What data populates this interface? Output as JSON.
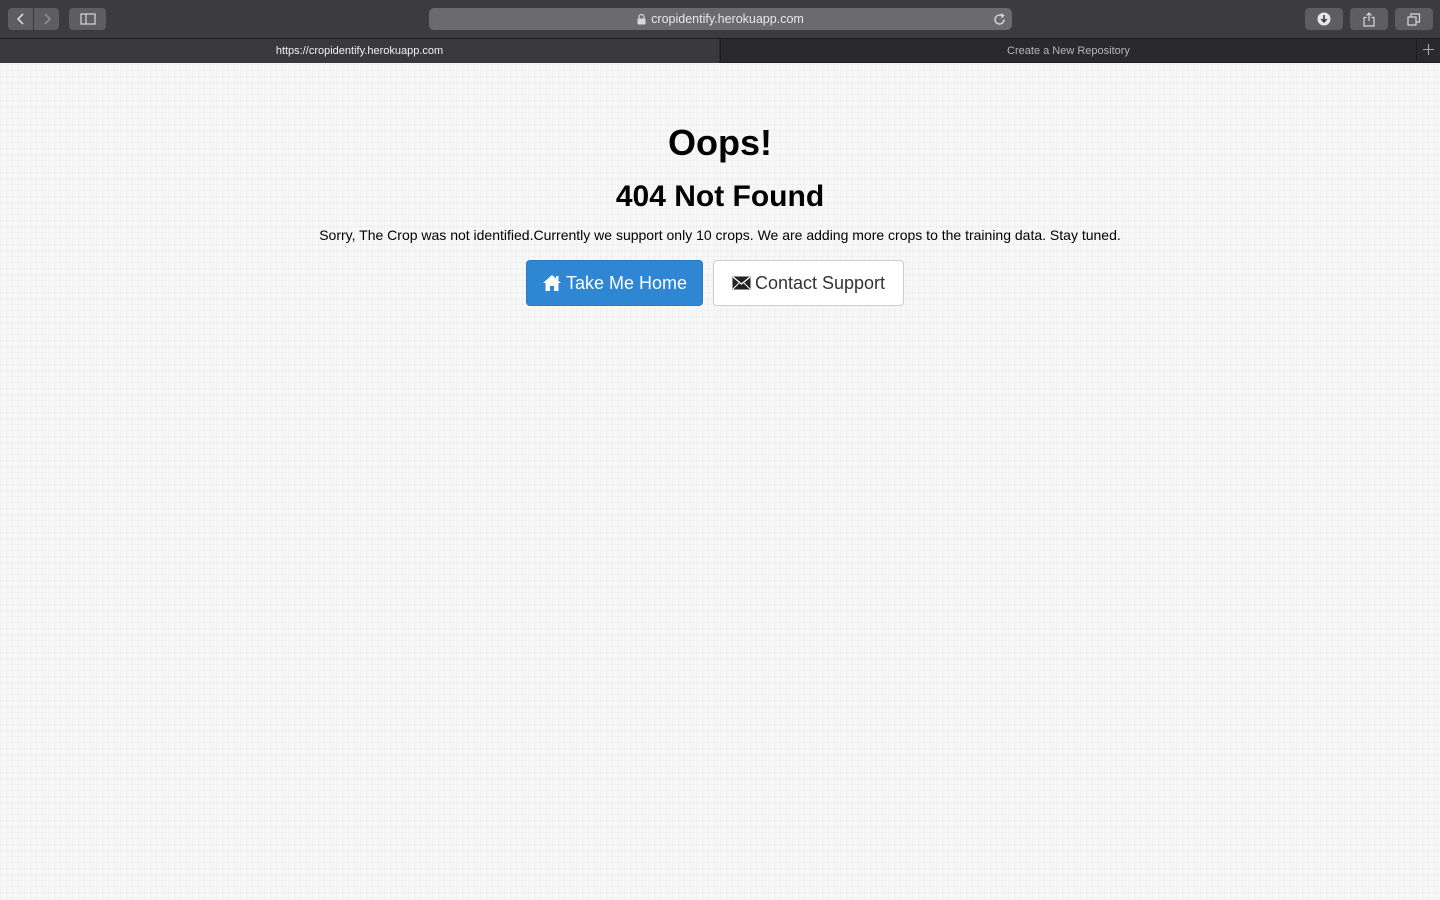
{
  "browser": {
    "address": "cropidentify.herokuapp.com",
    "tabs": [
      {
        "label": "https://cropidentify.herokuapp.com",
        "active": true
      },
      {
        "label": "Create a New Repository",
        "active": false
      }
    ],
    "icons": [
      "back-icon",
      "forward-icon",
      "sidebar-icon",
      "lock-icon",
      "reload-icon",
      "download-icon",
      "share-icon",
      "tabs-overview-icon",
      "new-tab-icon"
    ]
  },
  "page": {
    "heading": "Oops!",
    "subheading": "404 Not Found",
    "message": "Sorry, The Crop was not identified.Currently we support only 10 crops. We are adding more crops to the training data. Stay tuned.",
    "buttons": {
      "home_label": "Take Me Home",
      "home_icon": "home-icon",
      "support_label": "Contact Support",
      "support_icon": "envelope-icon"
    }
  },
  "colors": {
    "primary_button": "#2f86d3",
    "text": "#333333",
    "toolbar": "#3c3c3e"
  }
}
